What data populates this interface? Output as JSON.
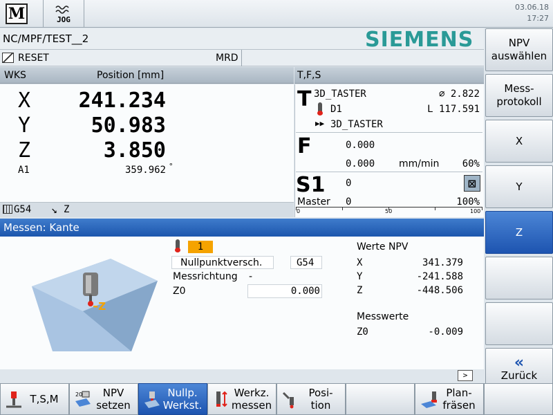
{
  "topbar": {
    "machine_icon_label": "M",
    "mode": "JOG",
    "date": "03.06.18",
    "time": "17:27"
  },
  "header": {
    "program_path": "NC/MPF/TEST__2",
    "brand": "SIEMENS",
    "channel_status": "RESET",
    "program_status": "MRD"
  },
  "position": {
    "coord_system": "WKS",
    "unit_label": "Position [mm]",
    "axes": [
      {
        "name": "X",
        "value": "241.234"
      },
      {
        "name": "Y",
        "value": "50.983"
      },
      {
        "name": "Z",
        "value": "3.850"
      }
    ],
    "aux_axis": {
      "name": "A1",
      "value": "359.962",
      "unit": "°"
    },
    "active_frame": "G54",
    "tool_direction": "Z"
  },
  "tfs": {
    "title": "T,F,S",
    "tool": {
      "letter": "T",
      "name": "3D_TASTER",
      "diameter": "⌀ 2.822",
      "edge": "D1",
      "length": "L 117.591",
      "next_tool": "3D_TASTER"
    },
    "feed": {
      "letter": "F",
      "actual": "0.000",
      "setpoint": "0.000",
      "unit": "mm/min",
      "override": "60%"
    },
    "spindle": {
      "letter": "S1",
      "label": "Master",
      "speed": "0",
      "load": "0",
      "override": "100%",
      "scale_min": "0",
      "scale_mid": "50",
      "scale_max": "100"
    }
  },
  "measure": {
    "title": "Messen: Kante",
    "tool_number": "1",
    "zero_offset_label": "Nullpunktversch.",
    "zero_offset_value": "G54",
    "direction_label": "Messrichtung",
    "direction_value": "-",
    "z0_label": "Z0",
    "z0_value": "0.000",
    "graphic_axis_label": "-Z",
    "npv_title": "Werte NPV",
    "npv": [
      {
        "axis": "X",
        "value": "341.379"
      },
      {
        "axis": "Y",
        "value": "-241.588"
      },
      {
        "axis": "Z",
        "value": "-448.506"
      }
    ],
    "measured_title": "Messwerte",
    "measured": [
      {
        "axis": "Z0",
        "value": "-0.009"
      }
    ]
  },
  "vertical_softkeys": [
    {
      "label": "NPV\nauswählen",
      "active": false
    },
    {
      "label": "Mess-\nprotokoll",
      "active": false
    },
    {
      "label": "X",
      "active": false
    },
    {
      "label": "Y",
      "active": false
    },
    {
      "label": "Z",
      "active": true
    },
    {
      "label": "",
      "active": false
    },
    {
      "label": "",
      "active": false
    },
    {
      "label": "Zurück",
      "icon": "double-chevron-left-icon",
      "active": false
    }
  ],
  "horizontal_softkeys": [
    {
      "label": "T,S,M",
      "icon": "tool-spindle-icon",
      "active": false
    },
    {
      "label": "NPV\nsetzen",
      "icon": "npv-set-icon",
      "active": false
    },
    {
      "label": "Nullp.\nWerkst.",
      "icon": "workpiece-zero-icon",
      "active": true
    },
    {
      "label": "Werkz.\nmessen",
      "icon": "tool-measure-icon",
      "active": false
    },
    {
      "label": "Posi-\ntion",
      "icon": "position-icon",
      "active": false
    },
    {
      "label": "",
      "active": false
    },
    {
      "label": "Plan-\nfräsen",
      "icon": "face-milling-icon",
      "active": false
    },
    {
      "label": "",
      "active": false
    }
  ],
  "colors": {
    "brand": "#2a9a97",
    "active_softkey": "#1d54b0",
    "title_bar": "#1c56ad",
    "tool_number_bg": "#f5a300",
    "probe_tip": "#e0231b"
  }
}
